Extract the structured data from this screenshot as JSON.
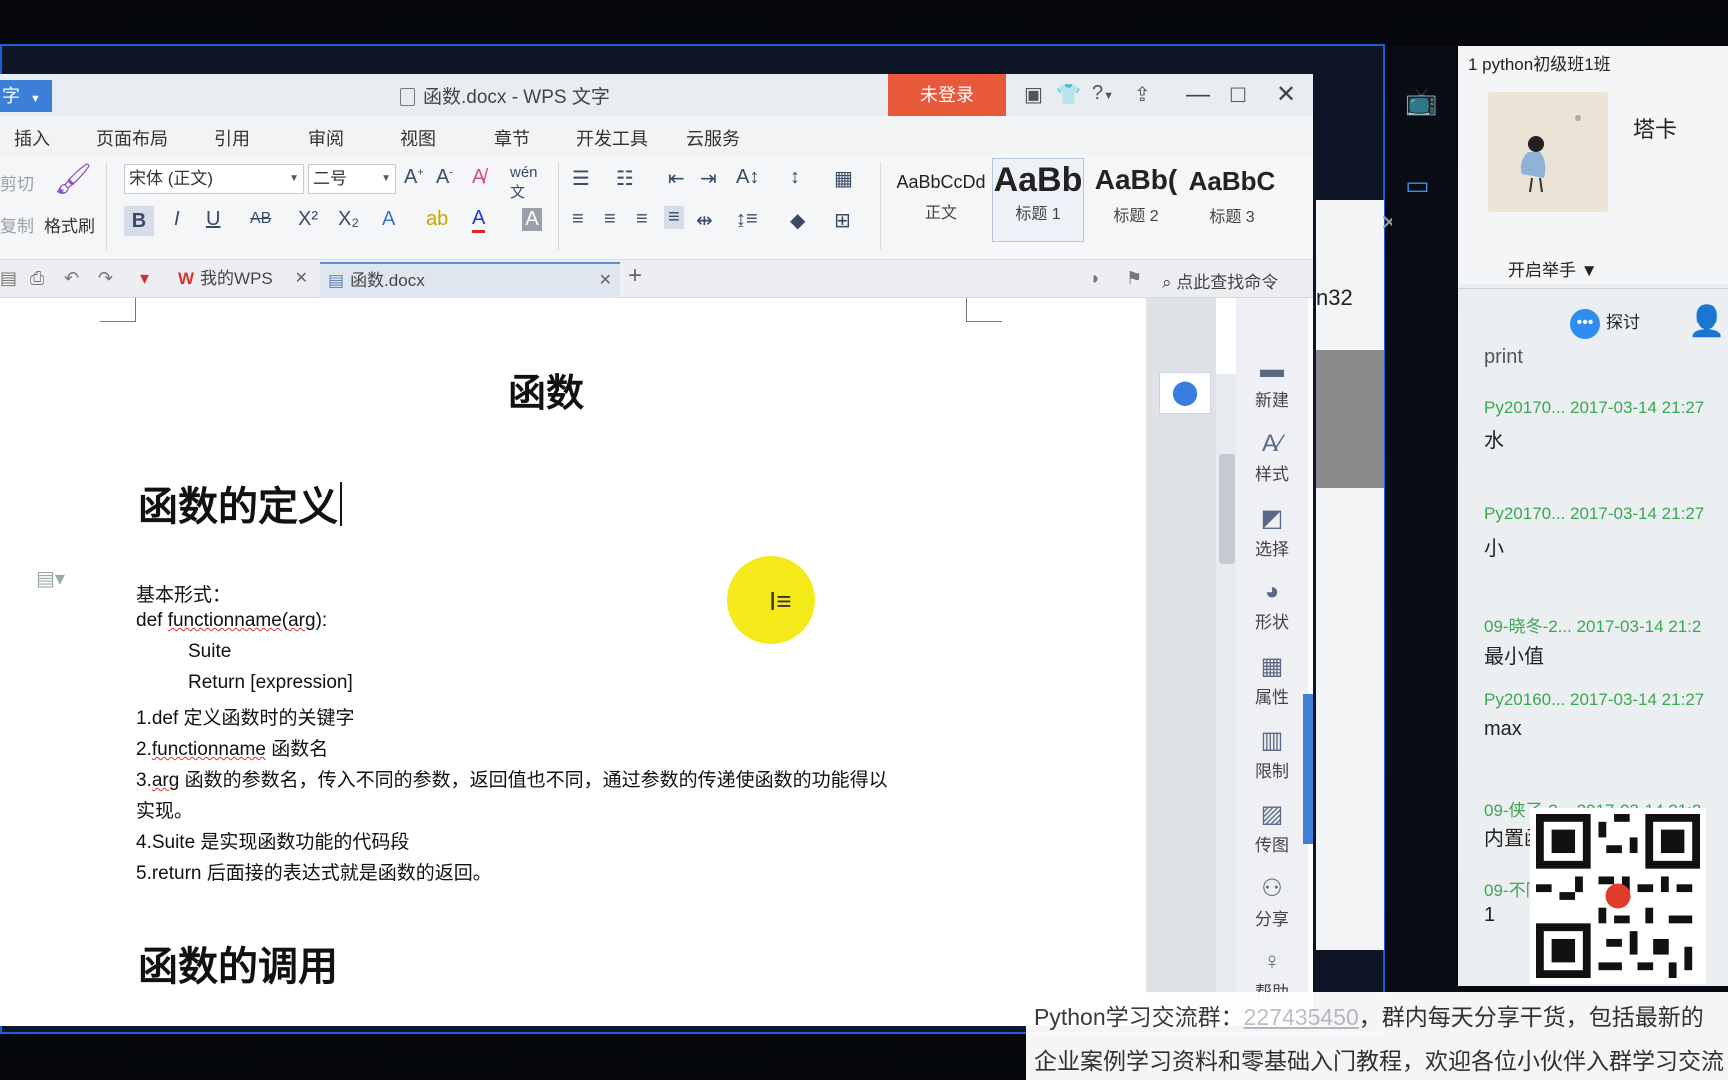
{
  "window": {
    "app_button": "字",
    "title": "函数.docx - WPS 文字",
    "login": "未登录",
    "help": "?",
    "minimize": "—",
    "maximize": "□",
    "close": "✕"
  },
  "menu": [
    "插入",
    "页面布局",
    "引用",
    "审阅",
    "视图",
    "章节",
    "开发工具",
    "云服务"
  ],
  "ribbon": {
    "cut": "剪切",
    "copy": "复制",
    "format_painter": "格式刷",
    "font_name": "宋体 (正文)",
    "font_size": "二号",
    "bold": "B",
    "italic": "I",
    "underline": "U",
    "strike": "AB",
    "superscript": "X²",
    "subscript": "X₂",
    "styles": [
      {
        "preview": "AaBbCcDd",
        "label": "正文"
      },
      {
        "preview": "AaBb",
        "label": "标题 1"
      },
      {
        "preview": "AaBb(",
        "label": "标题 2"
      },
      {
        "preview": "AaBbC",
        "label": "标题 3"
      }
    ]
  },
  "tabs": {
    "mywps_logo": "W",
    "mywps": "我的WPS",
    "doc": "函数.docx",
    "new_tab": "+",
    "search_cmd": "点此查找命令"
  },
  "document": {
    "title": "函数",
    "h2_definition": "函数的定义",
    "lines": {
      "basic_form": "基本形式：",
      "def_prefix": "def ",
      "def_fn": "functionname",
      "def_paren": "(",
      "def_arg": "arg",
      "def_suffix": "):",
      "suite": "Suite",
      "return": "Return [expression]",
      "p1": "1.def  定义函数时的关键字",
      "p2_prefix": "2.",
      "p2_fn": "functionname",
      "p2_suffix": "  函数名",
      "p3_prefix": "3.",
      "p3_arg": "arg",
      "p3_suffix": " 函数的参数名，传入不同的参数，返回值也不同，通过参数的传递使函数的功能得以",
      "p3_cont": "实现。",
      "p4": "4.Suite 是实现函数功能的代码段",
      "p5": "5.return  后面接的表达式就是函数的返回。"
    },
    "h2_call": "函数的调用"
  },
  "taskpane": [
    {
      "icon": "new-icon",
      "label": "新建"
    },
    {
      "icon": "style-icon",
      "label": "样式"
    },
    {
      "icon": "select-icon",
      "label": "选择"
    },
    {
      "icon": "shape-icon",
      "label": "形状"
    },
    {
      "icon": "property-icon",
      "label": "属性"
    },
    {
      "icon": "restrict-icon",
      "label": "限制"
    },
    {
      "icon": "send-image-icon",
      "label": "传图"
    },
    {
      "icon": "share-icon",
      "label": "分享"
    },
    {
      "icon": "assist-icon",
      "label": "帮助"
    }
  ],
  "background_window": {
    "partial_text": "n32"
  },
  "chat": {
    "class_title": "1 python初级班1班",
    "teacher": "塔卡",
    "raise_hand": "开启举手 ▼",
    "discuss": "探讨",
    "partial_top": "print",
    "messages": [
      {
        "meta": "Py20170... 2017-03-14 21:27",
        "text": "水"
      },
      {
        "meta": "Py20170... 2017-03-14 21:27",
        "text": "小"
      },
      {
        "meta": "09-晓冬-2... 2017-03-14 21:2",
        "text": "最小值"
      },
      {
        "meta": "Py20160... 2017-03-14 21:27",
        "text": "max"
      },
      {
        "meta": "09-侠了-2... 2017-03-14 21:2",
        "text": "内置函"
      },
      {
        "meta": "09-不同... 2017-03-14 21:2",
        "text": "1"
      }
    ]
  },
  "banner": {
    "line1_prefix": "Python学习交流群：",
    "line1_number": "227435450",
    "line1_suffix": "，群内每天分享干货，包括最新的",
    "line2": "企业案例学习资料和零基础入门教程，欢迎各位小伙伴入群学习交流"
  },
  "colors": {
    "accent": "#3c7fd9",
    "login": "#e8593b",
    "chat_meta": "#3aa84f",
    "cursor_highlight": "#f4ea1a"
  }
}
